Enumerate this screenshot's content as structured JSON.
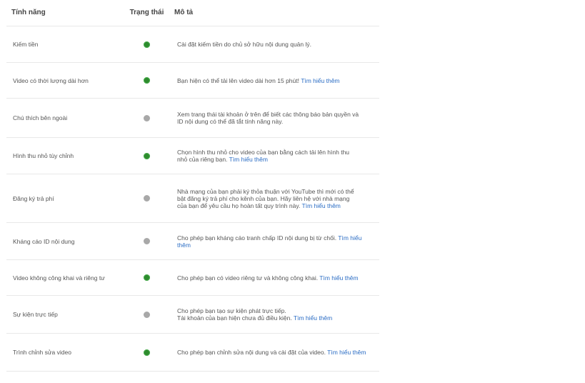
{
  "header": {
    "feature": "Tính năng",
    "status": "Trạng thái",
    "description": "Mô tả"
  },
  "colors": {
    "enabled": "#2e8b2e",
    "disabled": "#a8a8a8",
    "link": "#2a6cc4"
  },
  "rows": [
    {
      "feature": "Kiếm tiền",
      "status": "enabled",
      "lines": [
        "Cài đặt kiếm tiền do chủ sở hữu nội dung quản lý."
      ],
      "link": ""
    },
    {
      "feature": "Video có thời lượng dài hơn",
      "status": "enabled",
      "lines": [
        "Bạn hiện có thể tải lên video dài hơn 15 phút! "
      ],
      "link": "Tìm hiểu thêm"
    },
    {
      "feature": "Chú thích bên ngoài",
      "status": "disabled",
      "lines": [
        "Xem trang thái tài khoản ở trên để biết các thông báo bản quyền và",
        "ID nội dung có thể đã tắt tính năng này."
      ],
      "link": ""
    },
    {
      "feature": "Hình thu nhỏ tùy chỉnh",
      "status": "enabled",
      "lines": [
        "Chọn hình thu nhỏ cho video của bạn bằng cách tải lên hình thu",
        "nhỏ của riêng bạn. "
      ],
      "link": "Tìm hiểu thêm"
    },
    {
      "feature": "Đăng ký trả phí",
      "status": "disabled",
      "lines": [
        "Nhà mạng của bạn phải ký thỏa thuận với YouTube thì mới có thể",
        "bật đăng ký trả phí cho kênh của bạn. Hãy liên hệ với nhà mạng",
        "của bạn để yêu cầu họ hoàn tất quy trình này. "
      ],
      "link": "Tìm hiểu thêm"
    },
    {
      "feature": "Kháng cáo ID nội dung",
      "status": "disabled",
      "lines": [
        "Cho phép bạn kháng cáo tranh chấp ID nội dung bị từ chối. "
      ],
      "link": "Tìm hiểu thêm"
    },
    {
      "feature": "Video không công khai và riêng tư",
      "status": "enabled",
      "lines": [
        "Cho phép bạn có video riêng tư và không công khai. "
      ],
      "link": "Tìm hiểu thêm"
    },
    {
      "feature": "Sự kiện trực tiếp",
      "status": "disabled",
      "lines": [
        "Cho phép bạn tạo sự kiện phát trực tiếp.",
        "Tài khoản của bạn hiện chưa đủ điều kiện. "
      ],
      "link": "Tìm hiểu thêm"
    },
    {
      "feature": "Trình chỉnh sửa video",
      "status": "enabled",
      "lines": [
        "Cho phép bạn chỉnh sửa nội dung và cài đặt của video. "
      ],
      "link": "Tìm hiểu thêm"
    }
  ]
}
